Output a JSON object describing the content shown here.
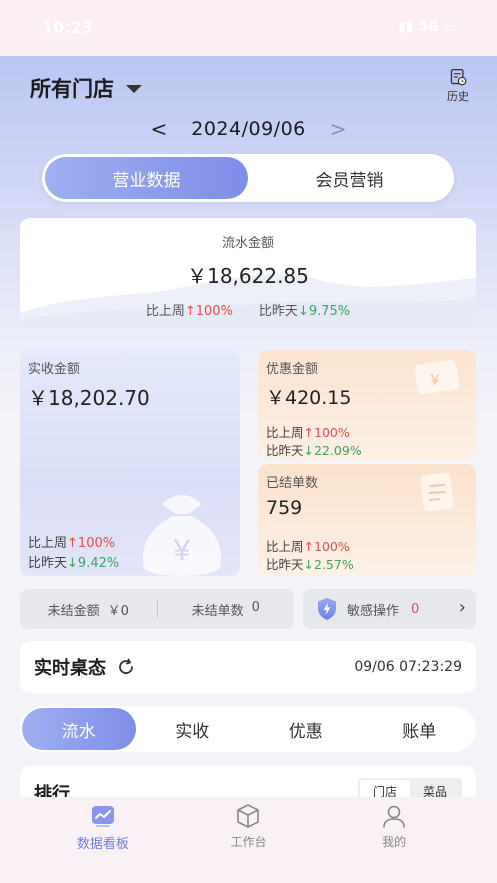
{
  "status_bar": {
    "time": "10:23",
    "network": "5G"
  },
  "header": {
    "store_title": "所有门店",
    "history_label": "历史"
  },
  "date_nav": {
    "date": "2024/09/06",
    "prev": "<",
    "next": ">"
  },
  "segment": {
    "tabs": [
      "营业数据",
      "会员营销"
    ],
    "active": 0
  },
  "flow": {
    "title": "流水金额",
    "value": "￥18,622.85",
    "week_label": "比上周",
    "week_value": "100%",
    "day_label": "比昨天",
    "day_value": "9.75%"
  },
  "paid": {
    "title": "实收金额",
    "value": "￥18,202.70",
    "week_label": "比上周",
    "week_value": "100%",
    "day_label": "比昨天",
    "day_value": "9.42%"
  },
  "discount": {
    "title": "优惠金额",
    "value": "￥420.15",
    "week_label": "比上周",
    "week_value": "100%",
    "day_label": "比昨天",
    "day_value": "22.09%"
  },
  "orders": {
    "title": "已结单数",
    "value": "759",
    "week_label": "比上周",
    "week_value": "100%",
    "day_label": "比昨天",
    "day_value": "2.57%"
  },
  "unsettled": {
    "amount_label": "未结金额",
    "amount_value": "￥0",
    "count_label": "未结单数",
    "count_value": "0"
  },
  "sensitive": {
    "label": "敏感操作",
    "count": "0"
  },
  "realtime": {
    "title": "实时桌态",
    "time": "09/06 07:23:29"
  },
  "tabs": [
    "流水",
    "实收",
    "优惠",
    "账单"
  ],
  "rank": {
    "title": "排行",
    "options": [
      "门店",
      "菜品"
    ]
  },
  "bottom_nav": [
    {
      "label": "数据看板",
      "icon": "chart-icon"
    },
    {
      "label": "工作台",
      "icon": "cube-icon"
    },
    {
      "label": "我的",
      "icon": "user-icon"
    }
  ],
  "colors": {
    "accent": "#7e8de8",
    "up": "#e4514a",
    "down": "#3ba55d"
  }
}
